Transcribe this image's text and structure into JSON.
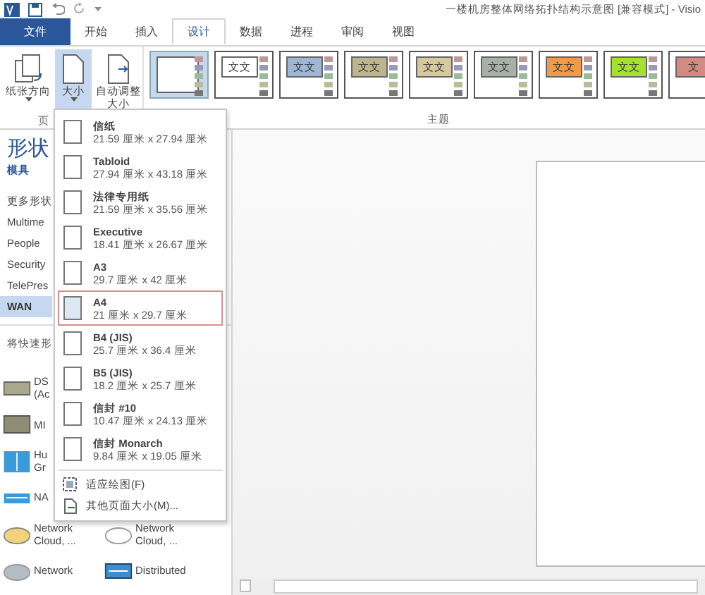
{
  "title_bar": {
    "title": "一楼机房整体网络拓扑结构示意图  [兼容模式] - Visio"
  },
  "ribbon_tabs": [
    {
      "label": "文件",
      "kind": "file",
      "selected": false
    },
    {
      "label": "开始",
      "kind": "tab",
      "selected": false
    },
    {
      "label": "插入",
      "kind": "tab",
      "selected": false
    },
    {
      "label": "设计",
      "kind": "tab",
      "selected": true
    },
    {
      "label": "数据",
      "kind": "tab",
      "selected": false
    },
    {
      "label": "进程",
      "kind": "tab",
      "selected": false
    },
    {
      "label": "审阅",
      "kind": "tab",
      "selected": false
    },
    {
      "label": "视图",
      "kind": "tab",
      "selected": false
    }
  ],
  "ribbon": {
    "buttons": [
      {
        "lines": [
          "纸张方向"
        ],
        "kind": "orientation",
        "pressed": false,
        "caret": true
      },
      {
        "lines": [
          "大小"
        ],
        "kind": "size",
        "pressed": true,
        "caret": true
      },
      {
        "lines": [
          "自动调整",
          "大小"
        ],
        "kind": "autosize",
        "pressed": false,
        "caret": false
      }
    ],
    "page_group_label": "页",
    "themes": [
      {
        "color": "#ffffff",
        "selected": true
      },
      {
        "label": "文文",
        "color": "#ffffff",
        "selected": false
      },
      {
        "label": "文文",
        "color": "#9fb7d4",
        "selected": false
      },
      {
        "label": "文文",
        "color": "#bdb58e",
        "selected": false
      },
      {
        "label": "文文",
        "color": "#d6c9a0",
        "selected": false
      },
      {
        "label": "文文",
        "color": "#a7b1a8",
        "selected": false
      },
      {
        "label": "文文",
        "color": "#f39a4a",
        "selected": false
      },
      {
        "label": "文文",
        "color": "#a6e22a",
        "selected": false
      },
      {
        "label": "文",
        "color": "#d48a80",
        "selected": false
      }
    ],
    "themes_group_label": "主题"
  },
  "shapes_pane": {
    "title": "形状",
    "tab": "模具",
    "stencils": [
      {
        "label": "更多形状",
        "selected": false
      },
      {
        "label": "Multime",
        "selected": false
      },
      {
        "label": "People",
        "selected": false
      },
      {
        "label": "Security",
        "selected": false
      },
      {
        "label": "TelePres",
        "selected": false
      },
      {
        "label": "WAN",
        "selected": true
      }
    ],
    "hint": "将快速形",
    "shapes": [
      {
        "kind": "box",
        "lines": [
          "DS",
          "(Ac"
        ]
      },
      {
        "kind": "darkbox",
        "lines": [
          "MI"
        ]
      },
      {
        "kind": "panel",
        "lines": [
          "Hu",
          "Gr"
        ]
      },
      {
        "kind": "bar",
        "lines": [
          "NA"
        ]
      },
      {
        "kind": "yellowcloud",
        "lines": [
          "Network",
          "Cloud, ..."
        ]
      },
      {
        "kind": "whitecloud",
        "lines": [
          "Network",
          "Cloud, ..."
        ]
      },
      {
        "kind": "graycloud",
        "lines": [
          "Network"
        ]
      },
      {
        "kind": "device",
        "lines": [
          "Distributed"
        ]
      }
    ]
  },
  "size_menu": {
    "items": [
      {
        "name": "信纸",
        "size": "21.59 厘米 x 27.94 厘米",
        "selected": false
      },
      {
        "name": "Tabloid",
        "size": "27.94 厘米 x 43.18 厘米",
        "selected": false
      },
      {
        "name": "法律专用纸",
        "size": "21.59 厘米 x 35.56 厘米",
        "selected": false
      },
      {
        "name": "Executive",
        "size": "18.41 厘米 x 26.67 厘米",
        "selected": false
      },
      {
        "name": "A3",
        "size": "29.7 厘米 x 42 厘米",
        "selected": false
      },
      {
        "name": "A4",
        "size": "21 厘米 x 29.7 厘米",
        "selected": true
      },
      {
        "name": "B4 (JIS)",
        "size": "25.7 厘米 x 36.4 厘米",
        "selected": false
      },
      {
        "name": "B5 (JIS)",
        "size": "18.2 厘米 x 25.7 厘米",
        "selected": false
      },
      {
        "name": "信封 #10",
        "size": "10.47 厘米 x 24.13 厘米",
        "selected": false
      },
      {
        "name": "信封 Monarch",
        "size": "9.84 厘米 x 19.05 厘米",
        "selected": false
      }
    ],
    "actions": [
      {
        "label": "适应绘图(F)",
        "kind": "fit"
      },
      {
        "label": "其他页面大小(M)...",
        "kind": "custom"
      }
    ]
  }
}
